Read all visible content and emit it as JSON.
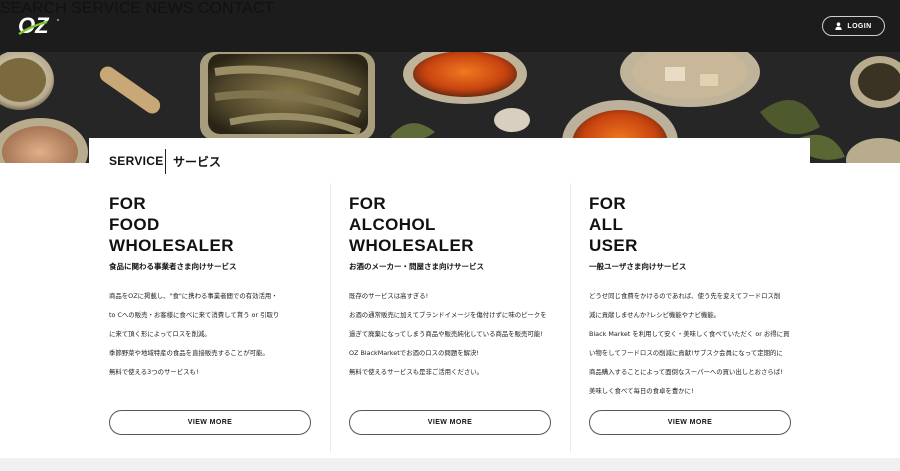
{
  "header": {
    "logo_text": "OZ",
    "nav": [
      {
        "label": "SEARCH"
      },
      {
        "label": "SERVICE"
      },
      {
        "label": "NEWS"
      },
      {
        "label": "CONTACT"
      }
    ],
    "login_label": "LOGIN",
    "accent_color": "#7cc42f"
  },
  "section": {
    "title": "SERVICE",
    "subtitle": "サービス"
  },
  "services": [
    {
      "heading": [
        "FOR",
        "FOOD",
        "WHOLESALER"
      ],
      "tagline": "食品に関わる事業者さま向けサービス",
      "lines": [
        "商品をOZに掲載し、\"食\"に携わる事業者間での有効活用・",
        "to Cへの販売・お客様に食べに来て消費して貰う or 引取り",
        "に来て頂く形によってロスを削減。",
        "季節野菜や地域特産の食品を直接販売することが可能。",
        "無料で使える3つのサービスも!"
      ],
      "button": "VIEW MORE"
    },
    {
      "heading": [
        "FOR",
        "ALCOHOL",
        "WHOLESALER"
      ],
      "tagline": "お酒のメーカー・問屋さま向けサービス",
      "lines": [
        "既存のサービスは高すぎる!",
        "お酒の通常販売に加えてブランドイメージを傷付けずに味のピークを",
        "過ぎて廃棄になってしまう商品や販売純化している商品を販売可能!",
        "OZ BlackMarketでお酒のロスの問題を解決!",
        "無料で使えるサービスも是非ご活用ください。"
      ],
      "button": "VIEW MORE"
    },
    {
      "heading": [
        "FOR",
        "ALL",
        "USER"
      ],
      "tagline": "一般ユーザさま向けサービス",
      "lines": [
        "どうせ同じ食費をかけるのであれば、使う先を変えてフードロス削",
        "減に貢献しませんか?レシピ機能やナビ機能。",
        "Black Market を利用して安く・美味しく食べていただく or お得に買",
        "い物をしてフードロスの削減に貢献!サブスク会員になって定期的に",
        "商品購入することによって面倒なスーパーへの買い出しとおさらば!",
        "美味しく食べて毎日の食卓を豊かに!"
      ],
      "button": "VIEW MORE"
    }
  ]
}
